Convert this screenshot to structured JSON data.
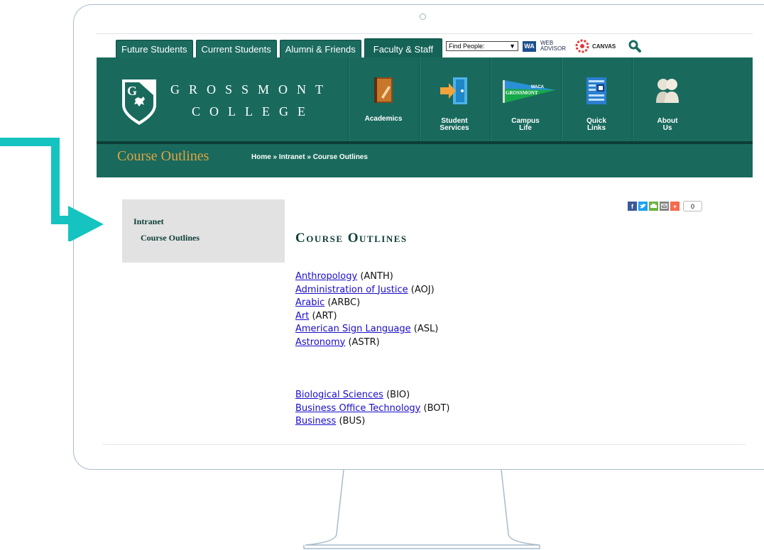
{
  "tabs": [
    {
      "label": "Future Students"
    },
    {
      "label": "Current Students"
    },
    {
      "label": "Alumni & Friends"
    },
    {
      "label": "Faculty & Staff"
    }
  ],
  "utility": {
    "find_people": "Find People:",
    "wa_badge": "WA",
    "wa_line1": "WEB",
    "wa_line2": "ADVISOR",
    "canvas": "CANVAS",
    "search_icon": "search-icon"
  },
  "logo": {
    "line1": "GROSSMONT",
    "line2": "COLLEGE",
    "shield_letter": "G"
  },
  "nav": [
    {
      "label": "Academics",
      "icon": "book-icon"
    },
    {
      "label": "Student Services",
      "icon": "door-arrow-icon"
    },
    {
      "label": "Campus Life",
      "icon": "pennant-icon"
    },
    {
      "label": "Quick Links",
      "icon": "document-icon"
    },
    {
      "label": "About Us",
      "icon": "people-icon"
    }
  ],
  "nav_labels": {
    "academics": "Academics",
    "student1": "Student",
    "student2": "Services",
    "campus1": "Campus",
    "campus2": "Life",
    "quick1": "Quick",
    "quick2": "Links",
    "about1": "About",
    "about2": "Us",
    "pennant_text1": "MACA",
    "pennant_text2": "GROSSMONT"
  },
  "page": {
    "title": "Course Outlines",
    "breadcrumb": "Home » Intranet » Course Outlines",
    "heading": "Course Outlines"
  },
  "sidebar": {
    "heading": "Intranet",
    "item": "Course Outlines"
  },
  "share": {
    "count": "0"
  },
  "courses_group1": [
    {
      "name": "Anthropology",
      "code": "(ANTH)"
    },
    {
      "name": "Administration of Justice",
      "code": "(AOJ)"
    },
    {
      "name": "Arabic",
      "code": "(ARBC)"
    },
    {
      "name": "Art",
      "code": "(ART)"
    },
    {
      "name": "American Sign Language",
      "code": "(ASL)"
    },
    {
      "name": "Astronomy",
      "code": "(ASTR)"
    }
  ],
  "courses_group2": [
    {
      "name": "Biological Sciences",
      "code": "(BIO)"
    },
    {
      "name": "Business Office Technology",
      "code": "(BOT)"
    },
    {
      "name": "Business",
      "code": "(BUS)"
    }
  ],
  "colors": {
    "brand_green": "#196a5d",
    "accent_gold": "#e0a341",
    "arrow_teal": "#15c3c0"
  }
}
